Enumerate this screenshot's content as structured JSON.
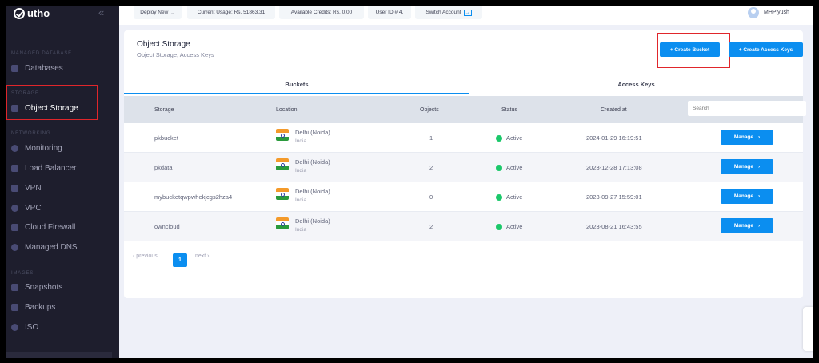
{
  "brand": {
    "name": "utho",
    "collapse_icon": "«"
  },
  "sidebar": {
    "sections": [
      {
        "label": "MANAGED DATABASE",
        "items": [
          {
            "label": "Databases",
            "icon": "database-icon"
          }
        ]
      },
      {
        "label": "STORAGE",
        "items": [
          {
            "label": "Object Storage",
            "icon": "bucket-icon"
          }
        ]
      },
      {
        "label": "NETWORKING",
        "items": [
          {
            "label": "Monitoring",
            "icon": "globe-icon"
          },
          {
            "label": "Load Balancer",
            "icon": "network-icon"
          },
          {
            "label": "VPN",
            "icon": "lock-icon"
          },
          {
            "label": "VPC",
            "icon": "share-icon"
          },
          {
            "label": "Cloud Firewall",
            "icon": "firewall-icon"
          },
          {
            "label": "Managed DNS",
            "icon": "globe-icon"
          }
        ]
      },
      {
        "label": "IMAGES",
        "items": [
          {
            "label": "Snapshots",
            "icon": "snapshot-icon"
          },
          {
            "label": "Backups",
            "icon": "backup-icon"
          },
          {
            "label": "ISO",
            "icon": "disc-icon"
          }
        ]
      }
    ],
    "active_item": "Object Storage"
  },
  "topbar": {
    "deploy": "Deploy New",
    "usage": "Current Usage: Rs. 51863.31",
    "credits": "Available Credits: Rs. 0.00",
    "user_id": "User ID # 4.",
    "switch": "Switch Account",
    "username": "MHPiyush"
  },
  "page": {
    "title": "Object Storage",
    "subtitle": "Object Storage, Access Keys",
    "create_bucket": "+ Create Bucket",
    "create_keys": "+ Create Access Keys",
    "tabs": [
      "Buckets",
      "Access Keys"
    ],
    "active_tab": "Buckets"
  },
  "table": {
    "headers": [
      "Storage",
      "Location",
      "Objects",
      "Status",
      "Created at"
    ],
    "search_placeholder": "Search",
    "rows": [
      {
        "storage": "pkbucket",
        "city": "Delhi (Noida)",
        "country": "India",
        "objects": "1",
        "status": "Active",
        "created": "2024-01-29 16:19:51",
        "action": "Manage"
      },
      {
        "storage": "pkdata",
        "city": "Delhi (Noida)",
        "country": "India",
        "objects": "2",
        "status": "Active",
        "created": "2023-12-28 17:13:08",
        "action": "Manage"
      },
      {
        "storage": "mybucketqwpwhekjcgs2hza4",
        "city": "Delhi (Noida)",
        "country": "India",
        "objects": "0",
        "status": "Active",
        "created": "2023-09-27 15:59:01",
        "action": "Manage"
      },
      {
        "storage": "owncloud",
        "city": "Delhi (Noida)",
        "country": "India",
        "objects": "2",
        "status": "Active",
        "created": "2023-08-21 16:43:55",
        "action": "Manage"
      }
    ]
  },
  "pagination": {
    "previous": "‹ previous",
    "current": "1",
    "next": "next ›"
  },
  "colors": {
    "accent": "#0b8ef0",
    "sidebar": "#1e1e2d",
    "active_status": "#1bc86a",
    "highlight": "#e0262b"
  }
}
